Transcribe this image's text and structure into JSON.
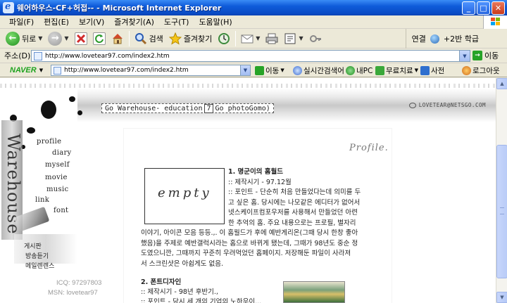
{
  "window": {
    "title": "웨어하우스-CF+허접-- - Microsoft Internet Explorer",
    "minimize_glyph": "_",
    "maximize_glyph": "□",
    "close_glyph": "✕"
  },
  "menu": {
    "items": [
      "파일(F)",
      "편집(E)",
      "보기(V)",
      "즐겨찾기(A)",
      "도구(T)",
      "도움말(H)"
    ]
  },
  "toolbar": {
    "back_label": "뒤로",
    "search_label": "검색",
    "favorites_label": "즐겨찾기",
    "connect_label": "연결",
    "links_label": "+2반 학급"
  },
  "address": {
    "label": "주소(D)",
    "url": "http://www.lovetear97.com/index2.htm",
    "go_label": "이동"
  },
  "naver": {
    "logo": "NAVER",
    "url": "http://www.lovetear97.com/index2.htm",
    "go_label": "이동",
    "realtime_label": "실시간검색어",
    "mypc_label": "내PC",
    "free_label": "무료치료",
    "dict_label": "사전",
    "logout_label": "로그아웃"
  },
  "page": {
    "go_warehouse": "Go Warehouse- education",
    "go_count": "7",
    "go_photo": "Go photoGomo)",
    "site_url": "LOVETEAR@NETSGO.COM",
    "logo_vertical": "Warehouse",
    "nav": [
      "profile",
      "diary",
      "myself",
      "movie",
      "music",
      "link",
      "font"
    ],
    "bottom_links": [
      "게시판",
      "방송듣기",
      "메일렌렌스"
    ],
    "icq": "ICQ: 97297803",
    "msn": "MSN: lovetear97",
    "profile_title": "Profile.",
    "empty_text": "empty",
    "section1_lines": [
      "1. 명군이의 홈월드",
      ":: 제작시기 - 97.12월",
      ":: 포인트 - 단순히 처음 만들었다는데 의미를 두",
      "고 싶은 홈. 당시에는 나모같은 에디터가 없어서",
      "넷스케이프컴포우저를 사용해서 만들었던 아련",
      "한 추억의 홈. 주요 내용으로는 프로필, 별자리",
      "이야기, 아이콘 모음 등등.,. 이 홈월드가 후에 예반게리온(그때 당시 한창 좋아",
      "했음)을 주제로 예반갤럭시라는 홈으로 바뀌게 됐는데, 그때가 98년도 중순 정",
      "도였으니깐, 그때까지 꾸준히 우려먹었던 홈페이지. 저장해둔 파일이 사라져",
      "서 스크린샷은 아쉽게도 없음."
    ],
    "section2_lines": [
      "2. 폰트디자인",
      ":: 제작시기 - 98년 후반기.,",
      ":: 포인트 - 당시 세 개의 기업의 노하우이..."
    ]
  }
}
